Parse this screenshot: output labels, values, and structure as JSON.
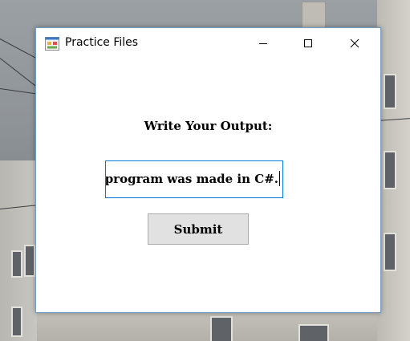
{
  "window": {
    "title": "Practice Files",
    "icon": "winforms-app-icon",
    "caption_buttons": [
      "minimize-icon",
      "maximize-icon",
      "close-icon"
    ]
  },
  "form": {
    "prompt_label": "Write Your Output:",
    "output_textbox": {
      "visible_value": "program was made in C#."
    },
    "submit_label": "Submit"
  },
  "colors": {
    "textbox_focus_border": "#0078d7",
    "button_face": "#e1e1e1",
    "button_border": "#adadad"
  }
}
